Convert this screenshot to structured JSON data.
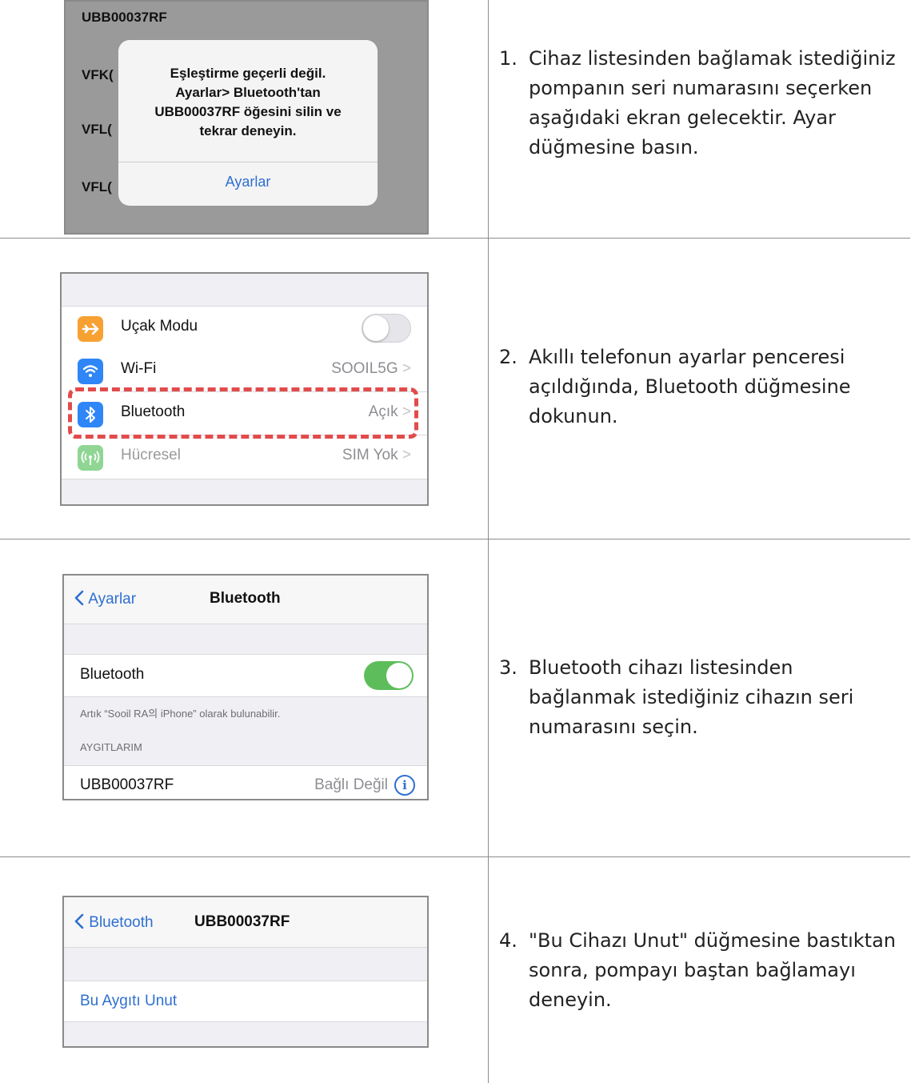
{
  "steps": [
    {
      "num": "1.",
      "text": "Cihaz listesinden bağlamak istediğiniz pompanın seri numarasını seçerken aşağıdaki ekran gelecektir. Ayar düğmesine basın."
    },
    {
      "num": "2.",
      "text": "Akıllı telefonun ayarlar penceresi açıldığında, Bluetooth düğmesine dokunun."
    },
    {
      "num": "3.",
      "text": "Bluetooth cihazı listesinden bağlanmak istediğiniz cihazın seri numarasını seçin."
    },
    {
      "num": "4.",
      "text": "\"Bu Cihazı Unut\" düğmesine bastıktan sonra, pompayı baştan bağlamayı deneyin."
    }
  ],
  "panel1": {
    "bg_items": [
      "UBB00037RF",
      "VFK(",
      "VFL(",
      "VFL("
    ],
    "alert_lines": [
      "Eşleştirme geçerli değil.",
      "Ayarlar> Bluetooth'tan",
      "UBB00037RF öğesini silin ve",
      "tekrar deneyin."
    ],
    "alert_button": "Ayarlar"
  },
  "panel2": {
    "rows": [
      {
        "label": "Uçak Modu",
        "value": "",
        "icon": "airplane-icon",
        "color": "#f7a133"
      },
      {
        "label": "Wi-Fi",
        "value": "SOOIL5G",
        "icon": "wifi-icon",
        "color": "#2f86f6"
      },
      {
        "label": "Bluetooth",
        "value": "Açık",
        "icon": "bluetooth-icon",
        "color": "#2f86f6"
      },
      {
        "label": "Hücresel",
        "value": "SIM Yok",
        "icon": "cellular-icon",
        "color": "#8fd694"
      }
    ],
    "chevron": ">"
  },
  "panel3": {
    "back": "Ayarlar",
    "title": "Bluetooth",
    "toggle_label": "Bluetooth",
    "discoverable": "Artık “Sooil RA의 iPhone” olarak bulunabilir.",
    "section": "AYGITLARIM",
    "device_name": "UBB00037RF",
    "device_status": "Bağlı Değil",
    "info_glyph": "i"
  },
  "panel4": {
    "back": "Bluetooth",
    "title": "UBB00037RF",
    "forget": "Bu Aygıtı Unut"
  },
  "colors": {
    "ios_blue": "#2f6fd0",
    "highlight_red": "#e24b4b",
    "toggle_green": "#5ebd5b"
  }
}
